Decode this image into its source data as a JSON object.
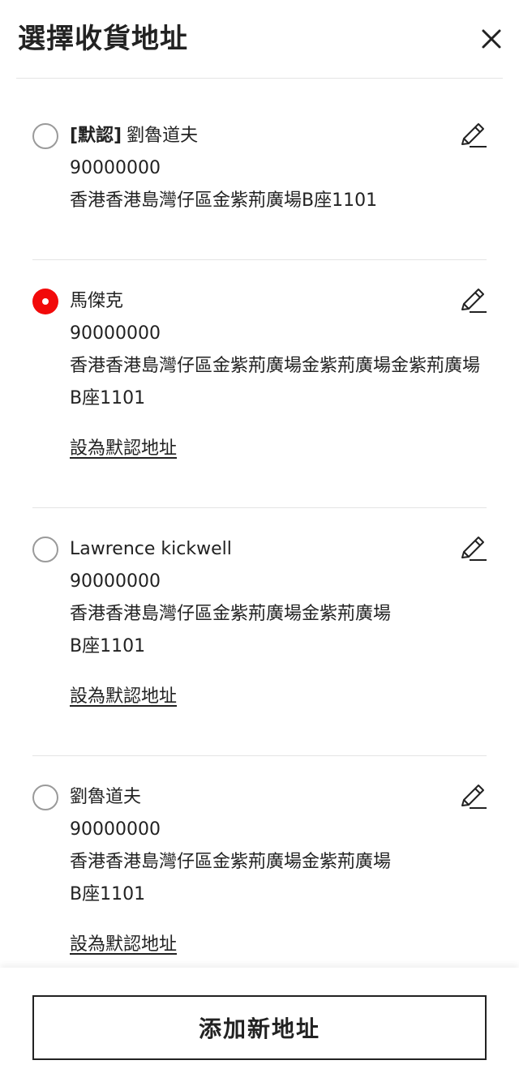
{
  "header": {
    "title": "選擇收貨地址",
    "close_icon": "close-icon"
  },
  "addresses": [
    {
      "default_tag": "[默認]",
      "name": "劉魯道夫",
      "phone": "90000000",
      "address": "香港香港島灣仔區金紫荊廣場B座1101",
      "selected": false,
      "is_default": true
    },
    {
      "name": "馬傑克",
      "phone": "90000000",
      "address": "香港香港島灣仔區金紫荊廣場金紫荊廣場金紫荊廣場B座1101",
      "selected": true,
      "set_default_label": "設為默認地址"
    },
    {
      "name": "Lawrence kickwell",
      "phone": "90000000",
      "address": "香港香港島灣仔區金紫荊廣場金紫荊廣場B座1101",
      "selected": false,
      "set_default_label": "設為默認地址"
    },
    {
      "name": "劉魯道夫",
      "phone": "90000000",
      "address": "香港香港島灣仔區金紫荊廣場金紫荊廣場B座1101",
      "selected": false,
      "set_default_label": "設為默認地址"
    }
  ],
  "footer": {
    "add_button_label": "添加新地址"
  },
  "colors": {
    "accent": "#f20a0a",
    "text": "#222222",
    "divider": "#e4e4e4",
    "radio_border": "#9a9a9a"
  }
}
